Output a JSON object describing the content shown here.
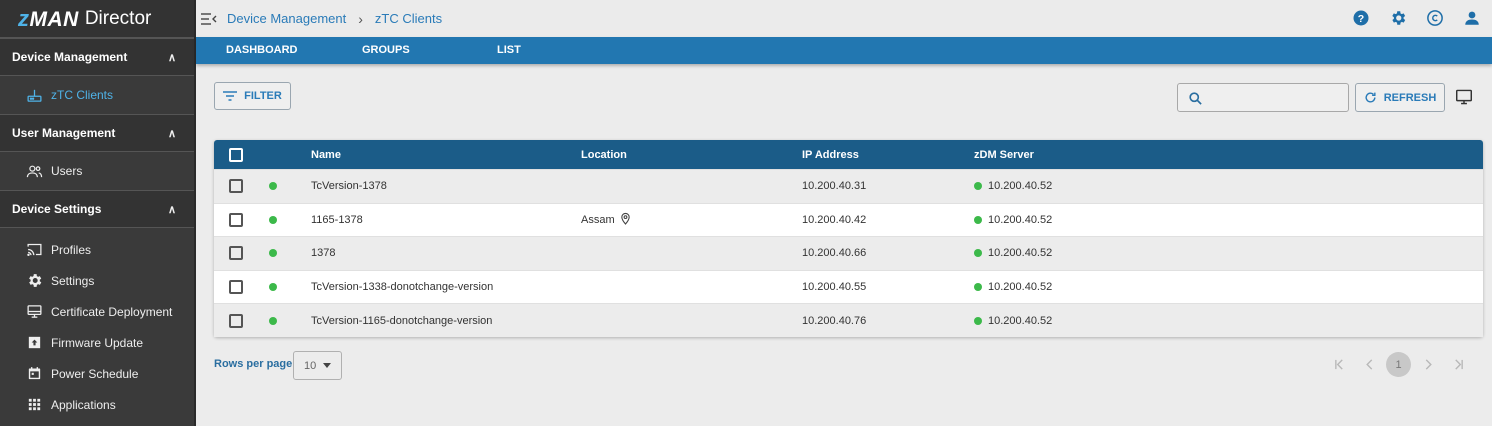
{
  "app": {
    "logo_brand": "zMAN",
    "logo_product": "Director"
  },
  "sidebar": {
    "sections": [
      {
        "title": "Device Management",
        "items": [
          {
            "label": "zTC Clients",
            "icon": "router-icon",
            "active": true
          }
        ]
      },
      {
        "title": "User Management",
        "items": [
          {
            "label": "Users",
            "icon": "users-icon"
          }
        ]
      },
      {
        "title": "Device Settings",
        "items": [
          {
            "label": "Profiles",
            "icon": "cast-icon"
          },
          {
            "label": "Settings",
            "icon": "gear-icon"
          },
          {
            "label": "Certificate Deployment",
            "icon": "monitor-icon"
          },
          {
            "label": "Firmware Update",
            "icon": "upload-box-icon"
          },
          {
            "label": "Power Schedule",
            "icon": "calendar-icon"
          },
          {
            "label": "Applications",
            "icon": "grid-icon"
          }
        ]
      }
    ]
  },
  "breadcrumb": {
    "root": "Device Management",
    "current": "zTC Clients"
  },
  "tabs": [
    "DASHBOARD",
    "GROUPS",
    "LIST"
  ],
  "toolbar": {
    "filter_label": "FILTER",
    "refresh_label": "REFRESH",
    "search_placeholder": ""
  },
  "table": {
    "columns": [
      "Name",
      "Location",
      "IP Address",
      "zDM Server"
    ],
    "rows": [
      {
        "name": "TcVersion-1378",
        "location": "",
        "ip": "10.200.40.31",
        "server": "10.200.40.52"
      },
      {
        "name": "1165-1378",
        "location": "Assam",
        "ip": "10.200.40.42",
        "server": "10.200.40.52"
      },
      {
        "name": "1378",
        "location": "",
        "ip": "10.200.40.66",
        "server": "10.200.40.52"
      },
      {
        "name": "TcVersion-1338-donotchange-version",
        "location": "",
        "ip": "10.200.40.55",
        "server": "10.200.40.52"
      },
      {
        "name": "TcVersion-1165-donotchange-version",
        "location": "",
        "ip": "10.200.40.76",
        "server": "10.200.40.52"
      }
    ]
  },
  "pagination": {
    "rows_per_page_label": "Rows per page",
    "rows_per_page": "10",
    "current_page": "1"
  },
  "colors": {
    "accent": "#2277b1",
    "header": "#1b5c88",
    "status_online": "#3cb94a",
    "sidebar_bg": "#3a3a3a",
    "link": "#2a7bb8"
  }
}
